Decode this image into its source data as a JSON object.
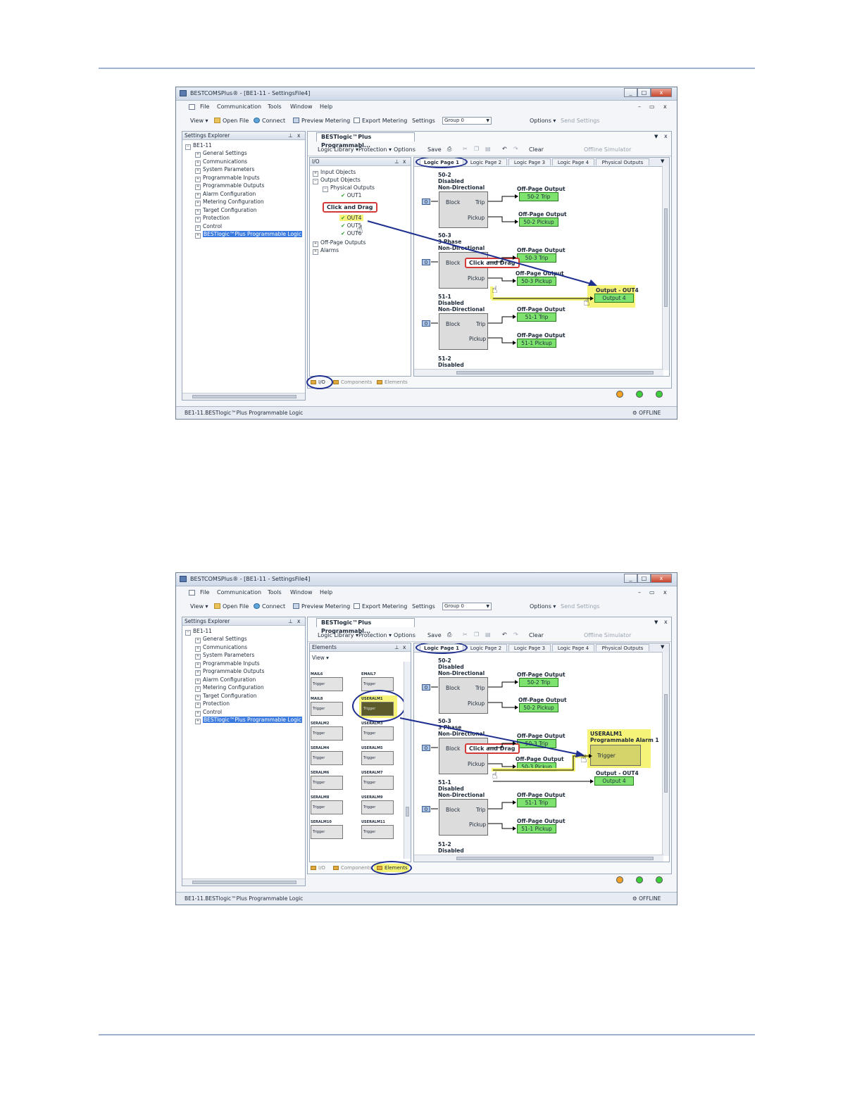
{
  "app": {
    "title": "BESTCOMSPlus® - [BE1-11 - SettingsFile4]",
    "window_buttons": [
      "_",
      "□",
      "x"
    ],
    "mdi_buttons": [
      "–",
      "▭",
      "x"
    ]
  },
  "menu": [
    "File",
    "Communication",
    "Tools",
    "Window",
    "Help"
  ],
  "toolbar": {
    "view": "View ▾",
    "open_file": "Open File",
    "connect": "Connect",
    "preview_metering": "Preview Metering",
    "export_metering": "Export Metering",
    "settings": "Settings",
    "group": "Group 0",
    "options": "Options ▾",
    "send_settings": "Send Settings"
  },
  "explorer": {
    "title": "Settings Explorer",
    "pin": "⊥",
    "close": "x",
    "root": "BE1-11",
    "items": [
      "General Settings",
      "Communications",
      "System Parameters",
      "Programmable Inputs",
      "Programmable Outputs",
      "Alarm Configuration",
      "Metering Configuration",
      "Target Configuration",
      "Protection",
      "Control",
      "BESTlogic™Plus Programmable Logic"
    ]
  },
  "document": {
    "tab": "BESTlogic™Plus Programmabl...",
    "logic_library": "Logic Library ▾",
    "protection": "Protection ▾",
    "options": "Options",
    "save": "Save",
    "clear": "Clear",
    "offline_simulator": "Offline Simulator",
    "logic_tabs": [
      "Logic Page 1",
      "Logic Page 2",
      "Logic Page 3",
      "Logic Page 4",
      "Physical Outputs"
    ],
    "bottom_tabs": [
      "I/O",
      "Components",
      "Elements"
    ]
  },
  "io_panel": {
    "title": "I/O",
    "input_objects": "Input Objects",
    "output_objects": "Output Objects",
    "physical_outputs": "Physical Outputs",
    "out1": "OUT1",
    "out4": "OUT4",
    "out5": "OUT5",
    "out6": "OUT6",
    "off_page": "Off-Page Outputs",
    "alarms": "Alarms"
  },
  "elements_panel": {
    "title": "Elements",
    "view": "View ▾",
    "trigger": "Trigger",
    "labels": [
      "MAIL6",
      "EMAIL7",
      "MAIL8",
      "USERALM1",
      "SERALM2",
      "USERALM3",
      "SERALM4",
      "USERALM5",
      "SERALM6",
      "USERALM7",
      "SERALM8",
      "USERALM9",
      "SERALM10",
      "USERALM11"
    ]
  },
  "diagram": {
    "blocks": [
      {
        "id": "50-2",
        "status": "Disabled",
        "mode": "Non-Directional"
      },
      {
        "id": "50-3",
        "status": "3 Phase",
        "mode": "Non-Directional"
      },
      {
        "id": "51-1",
        "status": "Disabled",
        "mode": "Non-Directional"
      },
      {
        "id": "51-2",
        "status": "Disabled",
        "mode": ""
      }
    ],
    "zero": "0",
    "block_in": "Block",
    "trip": "Trip",
    "pickup": "Pickup",
    "off_page_output": "Off-Page Output",
    "outputs": {
      "t502": "50-2 Trip",
      "p502": "50-2 Pickup",
      "t503": "50-3 Trip",
      "p503": "50-3 Pickup",
      "t511": "51-1 Trip",
      "p511": "51-1 Pickup"
    },
    "out4_title": "Output - OUT4",
    "out4_label": "Output 4",
    "alarm_title": "USERALM1",
    "alarm_subtitle": "Programmable Alarm 1",
    "alarm_input": "Trigger",
    "callout": "Click and Drag"
  },
  "statusbar": {
    "path": "BE1-11.BESTlogic™Plus Programmable Logic",
    "offline": "OFFLINE"
  },
  "colors": {
    "green_box": "#7de36e",
    "highlight": "#f4f36a",
    "callout_border": "#d33a3a",
    "ellipse": "#1f2f8f",
    "selection": "#3b7be0"
  }
}
